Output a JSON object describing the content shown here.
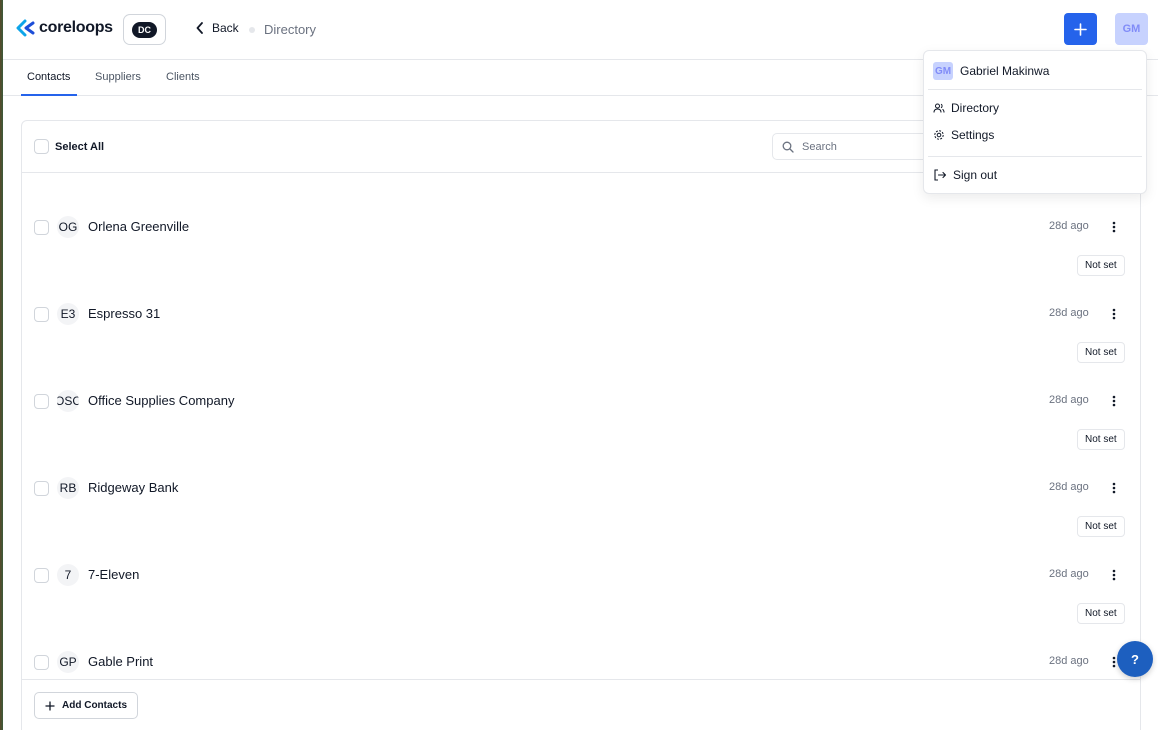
{
  "header": {
    "logo_text": "coreloops",
    "org_badge": "DC",
    "back_label": "Back",
    "breadcrumb": "Directory",
    "avatar_initials": "GM",
    "accent_color": "#2563eb"
  },
  "tabs": [
    {
      "label": "Contacts",
      "active": true
    },
    {
      "label": "Suppliers",
      "active": false
    },
    {
      "label": "Clients",
      "active": false
    }
  ],
  "list": {
    "select_all_label": "Select All",
    "search_placeholder": "Search",
    "rows": [
      {
        "initials": "OG",
        "name": "Orlena Greenville",
        "time": "28d ago",
        "status": "Not set"
      },
      {
        "initials": "E3",
        "name": "Espresso 31",
        "time": "28d ago",
        "status": "Not set"
      },
      {
        "initials": "OSC",
        "name": "Office Supplies Company",
        "time": "28d ago",
        "status": "Not set"
      },
      {
        "initials": "RB",
        "name": "Ridgeway Bank",
        "time": "28d ago",
        "status": "Not set"
      },
      {
        "initials": "7",
        "name": "7-Eleven",
        "time": "28d ago",
        "status": "Not set"
      },
      {
        "initials": "GP",
        "name": "Gable Print",
        "time": "28d ago",
        "status": ""
      }
    ],
    "add_button_label": "Add Contacts"
  },
  "menu": {
    "avatar_initials": "GM",
    "user_name": "Gabriel Makinwa",
    "items": [
      {
        "label": "Directory",
        "icon": "users-icon"
      },
      {
        "label": "Settings",
        "icon": "gear-icon"
      },
      {
        "label": "Sign out",
        "icon": "sign-out-icon"
      }
    ]
  },
  "help": {
    "label": "?"
  }
}
